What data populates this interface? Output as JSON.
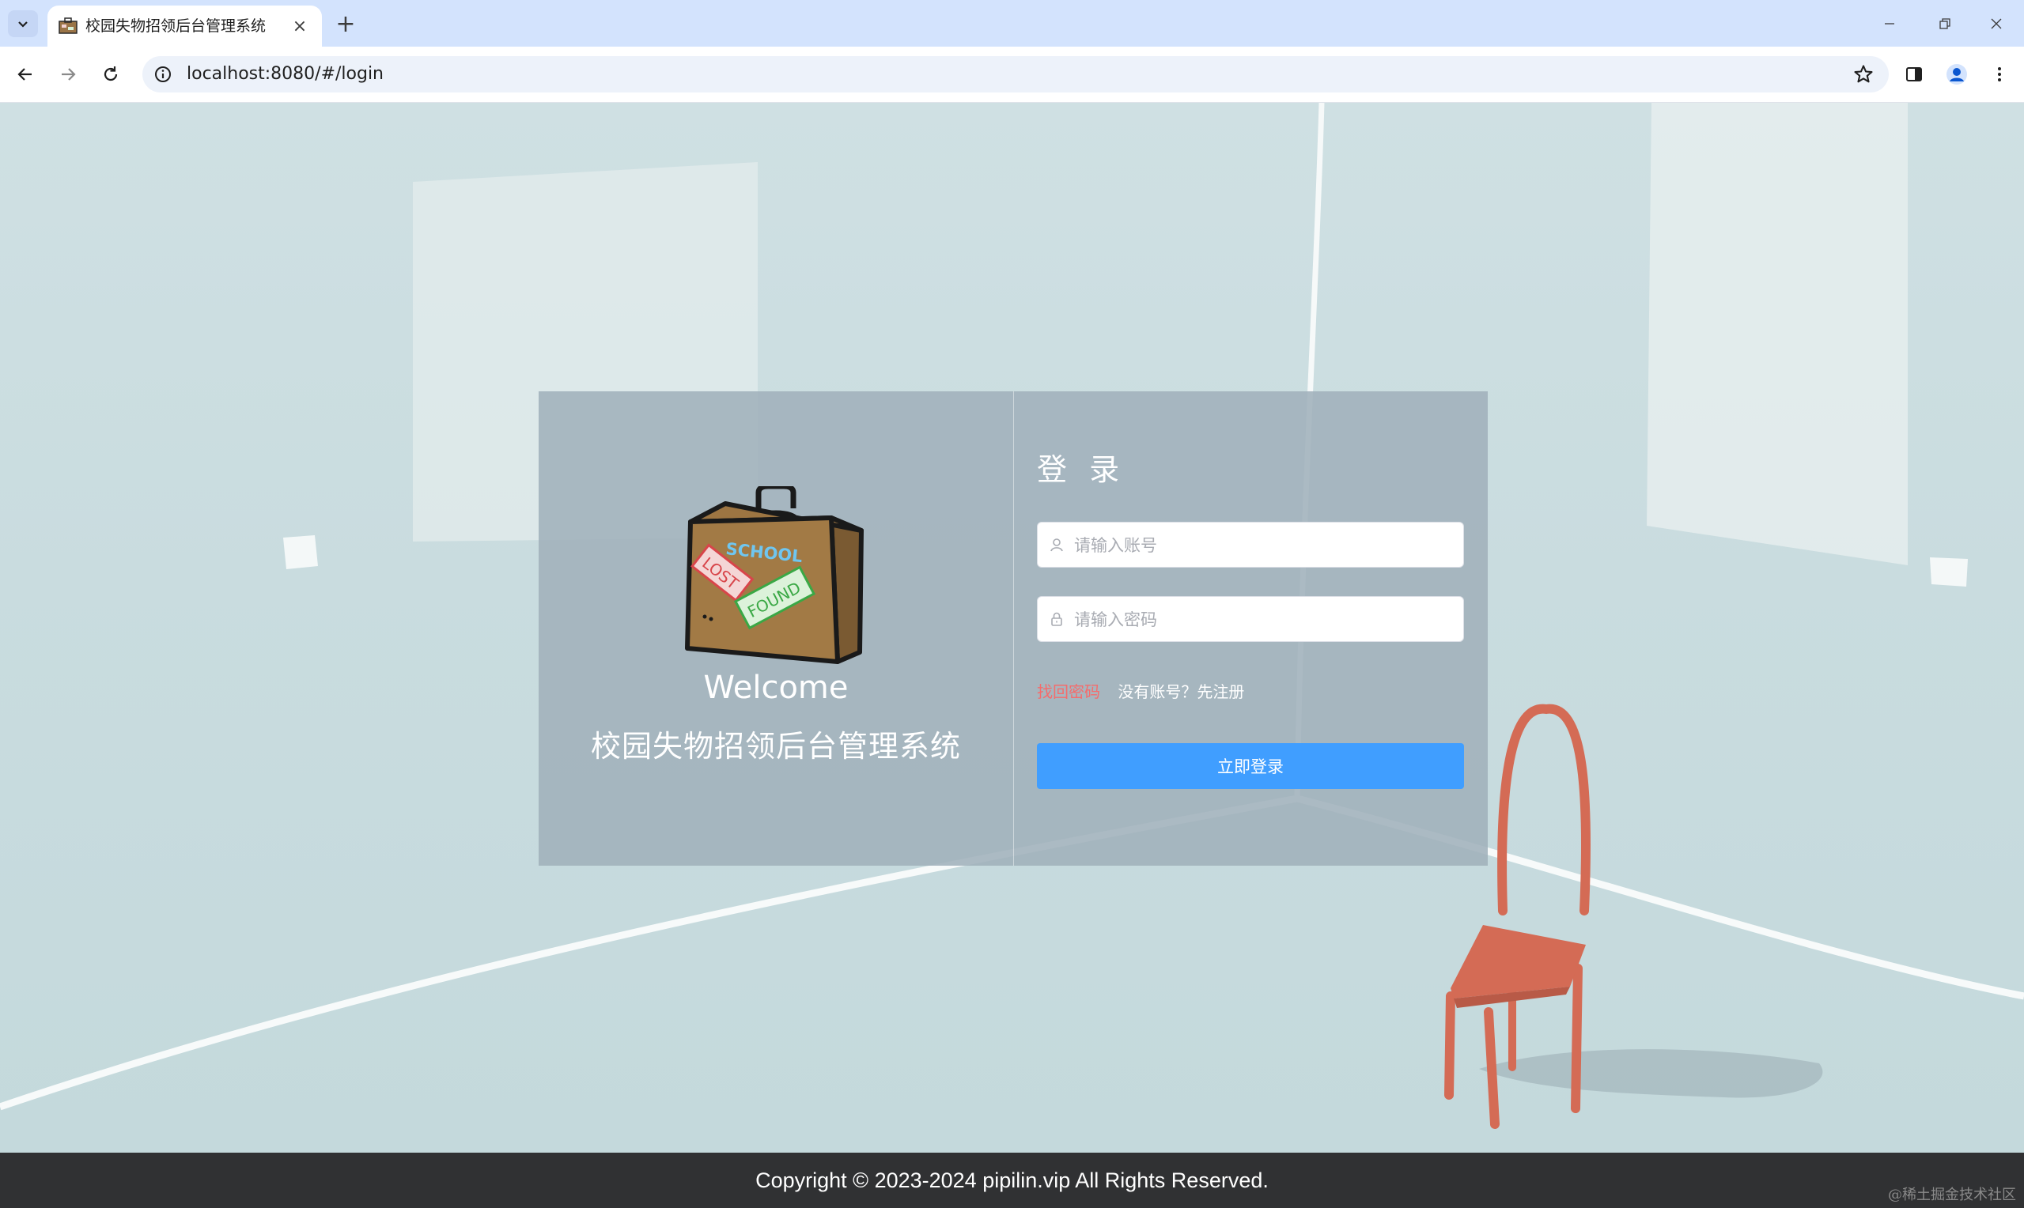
{
  "browser": {
    "tab_title": "校园失物招领后台管理系统",
    "url": "localhost:8080/#/login",
    "new_tab_symbol": "+",
    "close_symbol": "×"
  },
  "login": {
    "brand_welcome": "Welcome",
    "brand_name": "校园失物招领后台管理系统",
    "title": "登 录",
    "username_placeholder": "请输入账号",
    "password_placeholder": "请输入密码",
    "forgot_link": "找回密码",
    "register_link": "没有账号？先注册",
    "submit_label": "立即登录"
  },
  "footer": {
    "copyright": "Copyright © 2023-2024 pipilin.vip All Rights Reserved."
  },
  "watermark": "@稀土掘金技术社区",
  "colors": {
    "primary": "#409eff",
    "danger": "#f56c6c",
    "footer_bg": "#303133",
    "card_bg": "#a0b0bb"
  },
  "icons": {
    "tab_list": "chevron-down-icon",
    "back": "arrow-left-icon",
    "forward": "arrow-right-icon",
    "reload": "reload-icon",
    "site_info": "info-icon",
    "bookmark": "star-icon",
    "side_panel": "side-panel-icon",
    "profile": "profile-icon",
    "menu": "kebab-menu-icon",
    "username": "user-icon",
    "password": "lock-icon"
  }
}
